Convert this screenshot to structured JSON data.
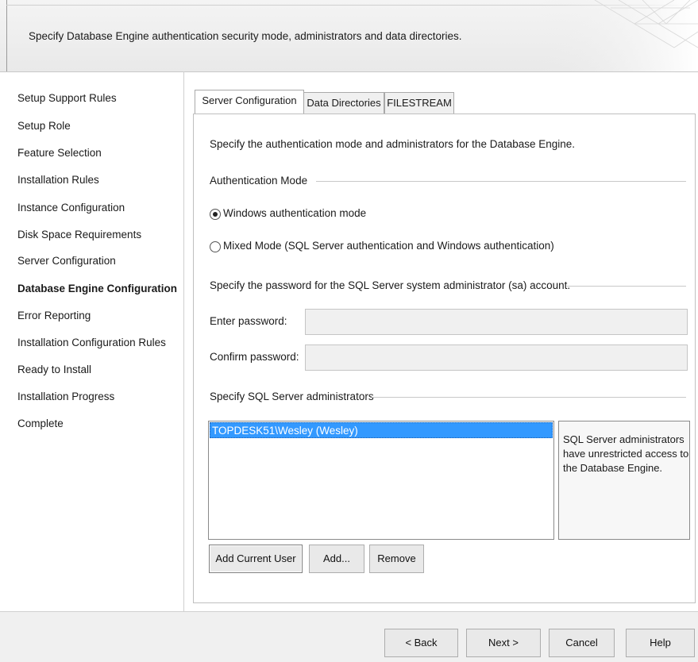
{
  "header": {
    "description": "Specify Database Engine authentication security mode, administrators and data directories."
  },
  "nav": {
    "items": [
      {
        "label": "Setup Support Rules",
        "active": false
      },
      {
        "label": "Setup Role",
        "active": false
      },
      {
        "label": "Feature Selection",
        "active": false
      },
      {
        "label": "Installation Rules",
        "active": false
      },
      {
        "label": "Instance Configuration",
        "active": false
      },
      {
        "label": "Disk Space Requirements",
        "active": false
      },
      {
        "label": "Server Configuration",
        "active": false
      },
      {
        "label": "Database Engine Configuration",
        "active": true
      },
      {
        "label": "Error Reporting",
        "active": false
      },
      {
        "label": "Installation Configuration Rules",
        "active": false
      },
      {
        "label": "Ready to Install",
        "active": false
      },
      {
        "label": "Installation Progress",
        "active": false
      },
      {
        "label": "Complete",
        "active": false
      }
    ]
  },
  "tabs": [
    {
      "label": "Server Configuration",
      "selected": true
    },
    {
      "label": "Data Directories",
      "selected": false
    },
    {
      "label": "FILESTREAM",
      "selected": false
    }
  ],
  "main": {
    "intro": "Specify the authentication mode and administrators for the Database Engine.",
    "auth_group_label": "Authentication Mode",
    "radio_windows": "Windows authentication mode",
    "radio_mixed": "Mixed Mode (SQL Server authentication and Windows authentication)",
    "selected_mode": "windows",
    "password_group_label": "Specify the password for the SQL Server system administrator (sa) account.",
    "enter_password_label": "Enter password:",
    "enter_password_value": "",
    "confirm_password_label": "Confirm password:",
    "confirm_password_value": "",
    "admins_group_label": "Specify SQL Server administrators",
    "admins": [
      "TOPDESK51\\Wesley (Wesley)"
    ],
    "admins_info": "SQL Server administrators have unrestricted access to the Database Engine.",
    "add_current_user_label": "Add Current User",
    "add_label": "Add...",
    "remove_label": "Remove"
  },
  "footer": {
    "back_label": "< Back",
    "next_label": "Next >",
    "cancel_label": "Cancel",
    "help_label": "Help"
  }
}
